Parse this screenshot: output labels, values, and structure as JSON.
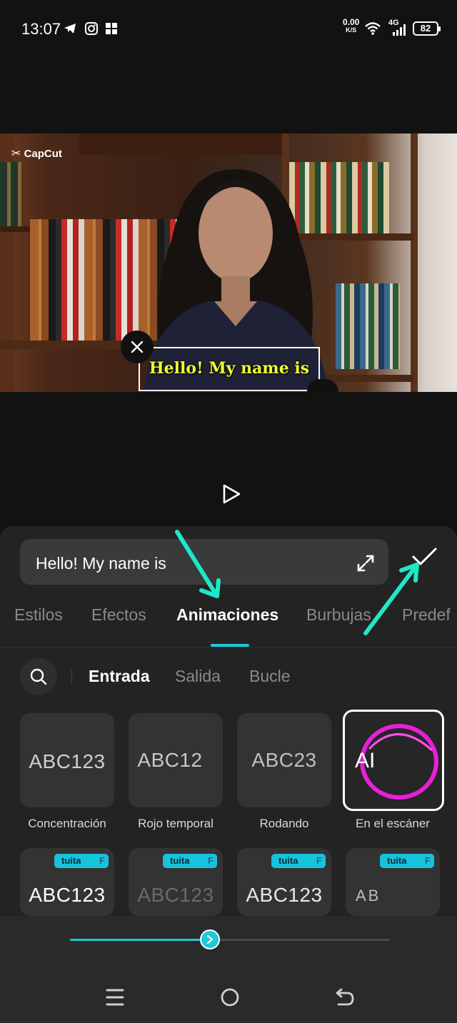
{
  "status_bar": {
    "time": "13:07",
    "net_speed_value": "0.00",
    "net_speed_unit": "K/S",
    "network": "4G",
    "battery": "82"
  },
  "video": {
    "watermark": "CapCut",
    "caption": "Hello! My name is",
    "caption_color": "#f2ff2e"
  },
  "editor": {
    "text_value": "Hello! My name is",
    "tabs": [
      "Estilos",
      "Efectos",
      "Animaciones",
      "Burbujas",
      "Predef"
    ],
    "active_tab": "Animaciones",
    "subtabs": [
      "Entrada",
      "Salida",
      "Bucle"
    ],
    "active_subtab": "Entrada",
    "animations_row1": [
      {
        "preview": "ABC123",
        "label": "Concentración"
      },
      {
        "preview": "ABC12",
        "label": "Rojo temporal"
      },
      {
        "preview": "ABC23",
        "label": "Rodando"
      },
      {
        "preview": "AI",
        "label": "En el escáner"
      }
    ],
    "animations_row2": [
      {
        "preview": "ABC123",
        "badge": "tuita"
      },
      {
        "preview": "ABC123",
        "badge": "tuita"
      },
      {
        "preview": "ABC123",
        "badge": "tuita"
      },
      {
        "preview": "AB",
        "badge": "tuita"
      }
    ],
    "selected_animation": "En el escáner",
    "accent_color": "#1ec8d8",
    "duration_slider_fraction": 0.44
  },
  "annotations": {
    "arrow_color": "#1de9c9"
  }
}
